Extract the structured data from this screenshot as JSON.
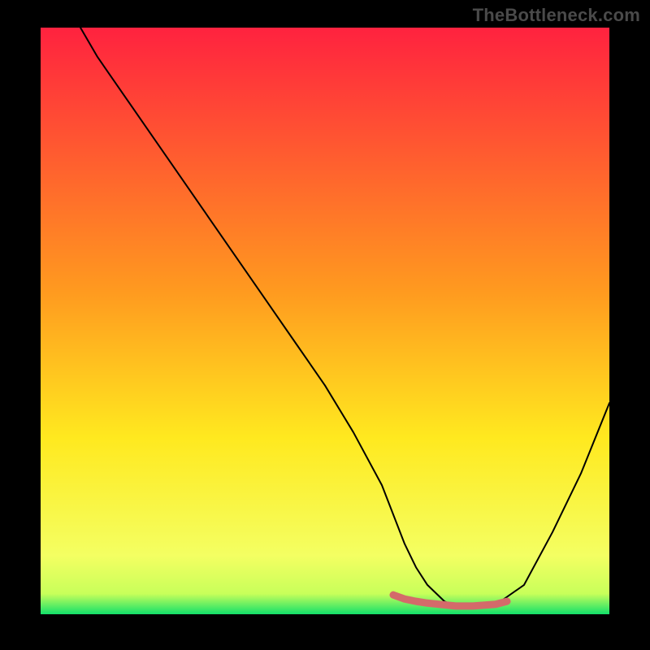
{
  "watermark": "TheBottleneck.com",
  "colors": {
    "frame": "#000000",
    "gradient_top": "#ff223f",
    "gradient_mid": "#ffd400",
    "gradient_low": "#f6ff60",
    "gradient_bottom": "#12e06a",
    "curve": "#000000",
    "highlight": "#d46a6a"
  },
  "chart_data": {
    "type": "line",
    "title": "",
    "xlabel": "",
    "ylabel": "",
    "xlim": [
      0,
      100
    ],
    "ylim": [
      0,
      100
    ],
    "curve": {
      "x": [
        7,
        10,
        15,
        20,
        25,
        30,
        35,
        40,
        45,
        50,
        55,
        60,
        62,
        64,
        66,
        68,
        71,
        73,
        76,
        80,
        85,
        90,
        95,
        100
      ],
      "y": [
        100,
        95,
        88,
        81,
        74,
        67,
        60,
        53,
        46,
        39,
        31,
        22,
        17,
        12,
        8,
        5,
        2.2,
        1.3,
        1.2,
        1.6,
        5,
        14,
        24,
        36
      ]
    },
    "highlight_band": {
      "x": [
        62,
        64,
        66,
        68,
        71,
        73,
        76,
        80,
        82
      ],
      "y": [
        3.3,
        2.6,
        2.2,
        1.9,
        1.6,
        1.4,
        1.4,
        1.7,
        2.2
      ]
    },
    "gradient_stops": [
      {
        "offset": 0.0,
        "color": "#ff223f"
      },
      {
        "offset": 0.45,
        "color": "#ff9a1f"
      },
      {
        "offset": 0.7,
        "color": "#ffe91f"
      },
      {
        "offset": 0.9,
        "color": "#f4ff62"
      },
      {
        "offset": 0.965,
        "color": "#c8ff5a"
      },
      {
        "offset": 1.0,
        "color": "#12e06a"
      }
    ]
  }
}
